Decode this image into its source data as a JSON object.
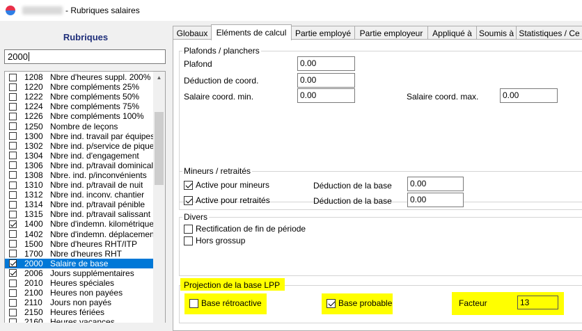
{
  "window": {
    "title": "- Rubriques salaires"
  },
  "left": {
    "heading": "Rubriques",
    "search_value": "2000",
    "items": [
      {
        "code": "1208",
        "label": "Nbre d'heures suppl. 200%",
        "checked": false
      },
      {
        "code": "1220",
        "label": "Nbre compléments 25%",
        "checked": false
      },
      {
        "code": "1222",
        "label": "Nbre compléments 50%",
        "checked": false
      },
      {
        "code": "1224",
        "label": "Nbre compléments 75%",
        "checked": false
      },
      {
        "code": "1226",
        "label": "Nbre compléments 100%",
        "checked": false
      },
      {
        "code": "1250",
        "label": "Nombre de leçons",
        "checked": false
      },
      {
        "code": "1300",
        "label": "Nbre ind. travail par équipes",
        "checked": false
      },
      {
        "code": "1302",
        "label": "Nbre ind. p/service de piquet",
        "checked": false
      },
      {
        "code": "1304",
        "label": "Nbre ind. d'engagement",
        "checked": false
      },
      {
        "code": "1306",
        "label": "Nbre ind. p/travail dominical",
        "checked": false
      },
      {
        "code": "1308",
        "label": "Nbre. ind. p/inconvénients",
        "checked": false
      },
      {
        "code": "1310",
        "label": "Nbre ind. p/travail de nuit",
        "checked": false
      },
      {
        "code": "1312",
        "label": "Nbre ind. inconv. chantier",
        "checked": false
      },
      {
        "code": "1314",
        "label": "Nbre ind. p/travail pénible",
        "checked": false
      },
      {
        "code": "1315",
        "label": "Nbre ind. p/travail salissant",
        "checked": false
      },
      {
        "code": "1400",
        "label": "Nbre d'indemn. kilométriques",
        "checked": true
      },
      {
        "code": "1402",
        "label": "Nbre d'indemn. déplacement",
        "checked": false
      },
      {
        "code": "1500",
        "label": "Nbre d'heures RHT/ITP",
        "checked": false
      },
      {
        "code": "1700",
        "label": "Nbre d'heures RHT",
        "checked": false
      },
      {
        "code": "2000",
        "label": "Salaire de base",
        "checked": true,
        "selected": true
      },
      {
        "code": "2006",
        "label": "Jours supplémentaires",
        "checked": true
      },
      {
        "code": "2010",
        "label": "Heures spéciales",
        "checked": false
      },
      {
        "code": "2100",
        "label": "Heures non payées",
        "checked": false
      },
      {
        "code": "2110",
        "label": "Jours non payés",
        "checked": false
      },
      {
        "code": "2150",
        "label": "Heures fériées",
        "checked": false
      },
      {
        "code": "2160",
        "label": "Heures vacances",
        "checked": false
      }
    ]
  },
  "tabs": [
    {
      "label": "Globaux",
      "active": false
    },
    {
      "label": "Eléments de calcul",
      "active": true
    },
    {
      "label": "Partie employé",
      "active": false
    },
    {
      "label": "Partie employeur",
      "active": false
    },
    {
      "label": "Appliqué à",
      "active": false
    },
    {
      "label": "Soumis à",
      "active": false
    },
    {
      "label": "Statistiques / Ce",
      "active": false
    }
  ],
  "plafonds": {
    "title": "Plafonds / planchers",
    "plafond_label": "Plafond",
    "plafond_value": "0.00",
    "deduction_label": "Déduction de coord.",
    "deduction_value": "0.00",
    "min_label": "Salaire coord. min.",
    "min_value": "0.00",
    "max_label": "Salaire coord. max.",
    "max_value": "0.00"
  },
  "mineurs": {
    "title": "Mineurs / retraités",
    "mineurs_label": "Active pour mineurs",
    "mineurs_checked": true,
    "mineurs_deduction_label": "Déduction de la base",
    "mineurs_deduction_value": "0.00",
    "retraites_label": "Active pour retraités",
    "retraites_checked": true,
    "retraites_deduction_label": "Déduction de la base",
    "retraites_deduction_value": "0.00"
  },
  "divers": {
    "title": "Divers",
    "rectification_label": "Rectification de fin de période",
    "rectification_checked": false,
    "grossup_label": "Hors grossup",
    "grossup_checked": false
  },
  "projection": {
    "title": "Projection de la base LPP",
    "retro_label": "Base rétroactive",
    "retro_checked": false,
    "probable_label": "Base probable",
    "probable_checked": true,
    "facteur_label": "Facteur",
    "facteur_value": "13"
  },
  "colors": {
    "highlight": "#ffff00",
    "selection": "#0078d7",
    "heading": "#1f2f7a"
  }
}
